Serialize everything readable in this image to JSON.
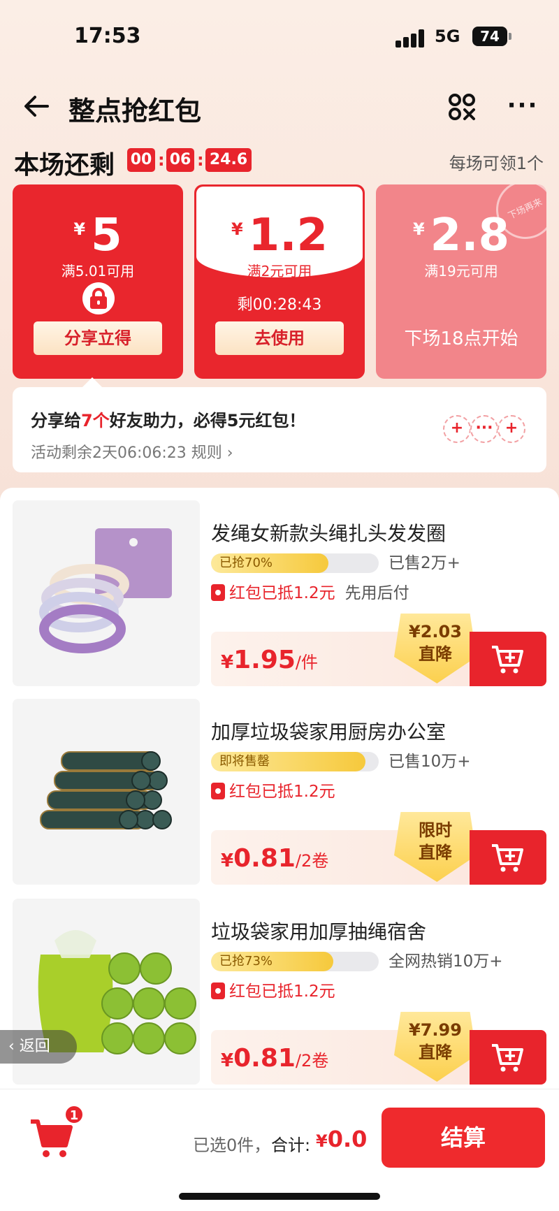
{
  "status_bar": {
    "time": "17:53",
    "network": "5G",
    "battery": "74"
  },
  "header": {
    "title": "整点抢红包"
  },
  "session": {
    "remain_label": "本场还剩",
    "countdown": [
      "00",
      "06",
      "24.6"
    ],
    "per_session": "每场可领1个"
  },
  "coupons": [
    {
      "currency": "¥",
      "amount": "5",
      "condition": "满5.01可用",
      "button": "分享立得"
    },
    {
      "currency": "¥",
      "amount": "1.2",
      "condition": "满2元可用",
      "timer": "剩00:28:43",
      "button": "去使用"
    },
    {
      "currency": "¥",
      "amount": "2.8",
      "condition": "满19元可用",
      "next": "下场18点开始",
      "stamp": "下场再来"
    }
  ],
  "share": {
    "text_prefix": "分享给",
    "count": "7个",
    "text_suffix": "好友助力，必得5元红包！",
    "activity": "活动剩余2天06:06:23 规则 ›",
    "avatars": [
      "+",
      "···",
      "+"
    ]
  },
  "products": [
    {
      "title": "发绳女新款头绳扎头发发圈",
      "progress_label": "已抢70%",
      "progress": 0.7,
      "sold": "已售2万+",
      "red_packet": "红包已抵1.2元",
      "extra": "先用后付",
      "price_currency": "¥",
      "price": "1.95",
      "unit": "/件",
      "badge_line1": "¥2.03",
      "badge_line2": "直降"
    },
    {
      "title": "加厚垃圾袋家用厨房办公室",
      "progress_label": "即将售罄",
      "progress": 0.92,
      "sold": "已售10万+",
      "red_packet": "红包已抵1.2元",
      "extra": "",
      "price_currency": "¥",
      "price": "0.81",
      "unit": "/2卷",
      "badge_line1": "限时",
      "badge_line2": "直降"
    },
    {
      "title": "垃圾袋家用加厚抽绳宿舍",
      "progress_label": "已抢73%",
      "progress": 0.73,
      "sold": "全网热销10万+",
      "red_packet": "红包已抵1.2元",
      "extra": "",
      "price_currency": "¥",
      "price": "0.81",
      "unit": "/2卷",
      "badge_line1": "¥7.99",
      "badge_line2": "直降"
    }
  ],
  "back_pill": "‹ 返回",
  "bottom": {
    "cart_badge": "1",
    "selected": "已选0件，",
    "total_label": "合计:",
    "total_currency": "¥",
    "total_value": "0.0",
    "checkout": "结算"
  },
  "colors": {
    "primary_red": "#e8242c",
    "coupon_faded": "#f2858a",
    "badge_yellow": "#fcd04e"
  }
}
